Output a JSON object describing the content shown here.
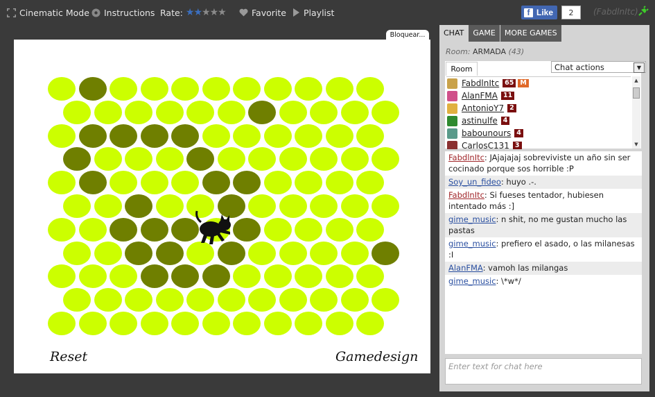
{
  "topbar": {
    "cinematic_label": "Cinematic Mode",
    "instructions_label": "Instructions",
    "rate_label": "Rate:",
    "rating": 2,
    "rating_max": 5,
    "favorite_label": "Favorite",
    "playlist_label": "Playlist",
    "fb_like_label": "Like",
    "fb_count": "2",
    "username": "(FabdlnItc)",
    "colors": {
      "star_on": "#3b6fbf",
      "star_off": "#8a8a8a",
      "plug": "#3ecb2a"
    }
  },
  "game": {
    "block_tab_label": "Bloquear...",
    "reset_label": "Reset",
    "gamedesign_label": "Gamedesign",
    "grid": {
      "rows": 11,
      "cols": 11,
      "blocked": [
        [
          0,
          1
        ],
        [
          1,
          6
        ],
        [
          2,
          1
        ],
        [
          2,
          2
        ],
        [
          2,
          3
        ],
        [
          2,
          4
        ],
        [
          3,
          0
        ],
        [
          3,
          4
        ],
        [
          4,
          1
        ],
        [
          4,
          5
        ],
        [
          4,
          6
        ],
        [
          5,
          2
        ],
        [
          5,
          5
        ],
        [
          6,
          2
        ],
        [
          6,
          3
        ],
        [
          6,
          4
        ],
        [
          6,
          6
        ],
        [
          7,
          2
        ],
        [
          7,
          3
        ],
        [
          7,
          5
        ],
        [
          7,
          10
        ],
        [
          8,
          3
        ],
        [
          8,
          4
        ],
        [
          8,
          5
        ]
      ],
      "cat_position": [
        6,
        5
      ],
      "colors": {
        "free": "#ccff00",
        "blocked": "#6f7f00",
        "cat": "#111111"
      }
    }
  },
  "panel": {
    "tabs": [
      {
        "label": "CHAT",
        "active": true
      },
      {
        "label": "GAME",
        "active": false
      },
      {
        "label": "MORE GAMES",
        "active": false
      }
    ],
    "room_prefix": "Room:",
    "room_name": "ARMADA",
    "room_count": "(43)",
    "room_tab_label": "Room",
    "chat_actions_label": "Chat actions",
    "users": [
      {
        "name": "FabdlnItc",
        "level": "65",
        "mod": "M",
        "avatar_color": "#c9a24a"
      },
      {
        "name": "AlanFMA",
        "level": "11",
        "mod": "",
        "avatar_color": "#d0508a"
      },
      {
        "name": "AntonioY7",
        "level": "2",
        "mod": "",
        "avatar_color": "#e0b040"
      },
      {
        "name": "astinulfe",
        "level": "4",
        "mod": "",
        "avatar_color": "#2f8a2f"
      },
      {
        "name": "babounours",
        "level": "4",
        "mod": "",
        "avatar_color": "#5a9a8a"
      },
      {
        "name": "CarlosC131",
        "level": "3",
        "mod": "",
        "avatar_color": "#8a3030"
      }
    ],
    "messages": [
      {
        "user": "FabdlnItc",
        "color": "red",
        "text": ": JAjajajaj sobreviviste un año sin ser cocinado porque sos horrible :P"
      },
      {
        "user": "Soy_un_fideo",
        "color": "blue",
        "text": ": huyo .-."
      },
      {
        "user": "FabdlnItc",
        "color": "red",
        "text": ": Si fueses tentador, hubiesen intentado más :]"
      },
      {
        "user": "gime_music",
        "color": "blue",
        "text": ": n shit, no me gustan mucho las pastas"
      },
      {
        "user": "gime_music",
        "color": "blue",
        "text": ": prefiero el asado, o las milanesas :I"
      },
      {
        "user": "AlanFMA",
        "color": "blue",
        "text": ": vamoh las milangas"
      },
      {
        "user": "gime_music",
        "color": "blue",
        "text": ": \\*w*/"
      }
    ],
    "input_placeholder": "Enter text for chat here"
  }
}
